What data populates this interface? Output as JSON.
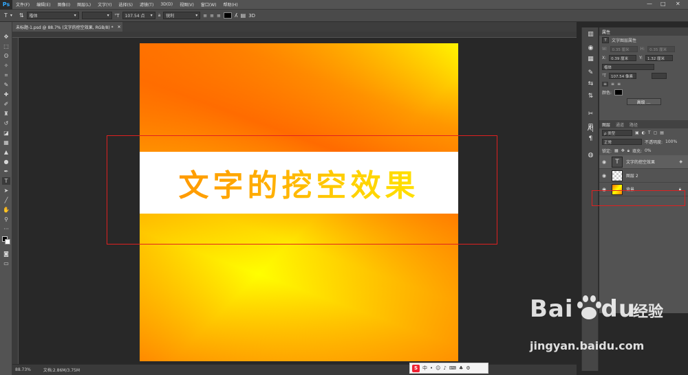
{
  "menubar": {
    "logo": "Ps",
    "items": [
      "文件(F)",
      "编辑(E)",
      "图像(I)",
      "图层(L)",
      "文字(Y)",
      "选择(S)",
      "滤镜(T)",
      "3D(D)",
      "视图(V)",
      "窗口(W)",
      "帮助(H)"
    ],
    "minimize": "—",
    "maximize": "□",
    "close": "✕"
  },
  "options": {
    "font_family": "楷体",
    "font_size": "107.54 点",
    "aa_prefix": "a",
    "aa_mode": "锐利"
  },
  "document": {
    "tab_label": "未标题-1.psd @ 88.7% (文字的挖空效果, RGB/8) *",
    "text": "文字的挖空效果"
  },
  "status": {
    "zoom": "88.73%",
    "doc_size": "文档:2.86M/3.75M"
  },
  "properties": {
    "title": "属性",
    "subtitle": "文字图层属性",
    "w_label": "W:",
    "w_value": "0.35 厘米",
    "h_label": "H:",
    "h_value": "0.35 厘米",
    "x_label": "X:",
    "x_value": "0.39 厘米",
    "y_label": "Y:",
    "y_value": "1.32 厘米",
    "font_family": "楷体",
    "font_size": "107.54 像素",
    "color_label": "颜色:",
    "advanced_button": "高级 ..."
  },
  "layers_panel": {
    "tabs": [
      "图层",
      "通道",
      "路径"
    ],
    "filter_kind": "ρ 类型",
    "blend_mode": "正常",
    "opacity_label": "不透明度:",
    "opacity_value": "100%",
    "lock_label": "锁定:",
    "fill_label": "填充:",
    "fill_value": "0%",
    "layers": [
      {
        "name": "文字的挖空效果",
        "type": "text"
      },
      {
        "name": "图层 2",
        "type": "transparent"
      },
      {
        "name": "背景",
        "type": "background"
      }
    ]
  },
  "watermark": {
    "brand": "Bai",
    "brand2": "du",
    "jingyan": "经验",
    "url": "jingyan.baidu.com"
  },
  "ime": {
    "logo": "S",
    "mode": "中"
  }
}
